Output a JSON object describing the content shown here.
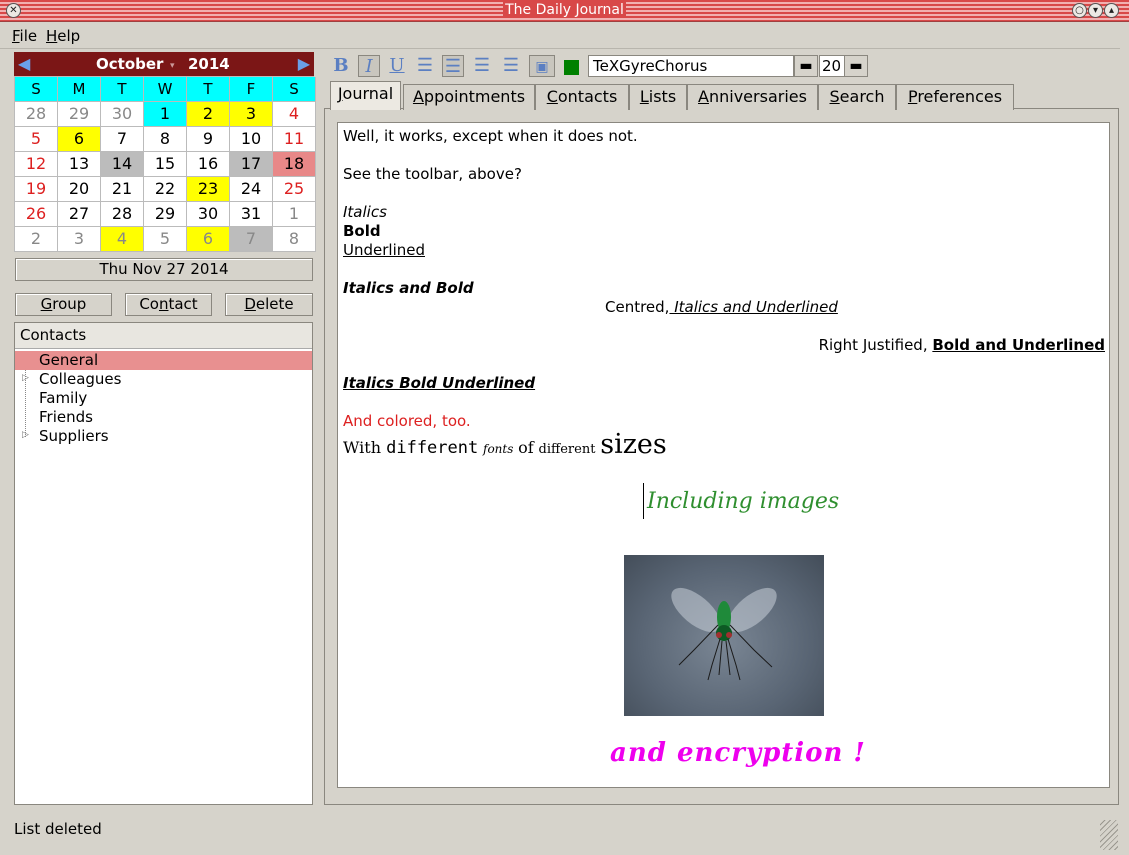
{
  "window": {
    "title": "The Daily Journal"
  },
  "menu": {
    "file": "File",
    "help": "Help"
  },
  "calendar": {
    "month": "October",
    "year": "2014",
    "weekdays": [
      "S",
      "M",
      "T",
      "W",
      "T",
      "F",
      "S"
    ],
    "weeks": [
      [
        "28",
        "29",
        "30",
        "1",
        "2",
        "3",
        "4"
      ],
      [
        "5",
        "6",
        "7",
        "8",
        "9",
        "10",
        "11"
      ],
      [
        "12",
        "13",
        "14",
        "15",
        "16",
        "17",
        "18"
      ],
      [
        "19",
        "20",
        "21",
        "22",
        "23",
        "24",
        "25"
      ],
      [
        "26",
        "27",
        "28",
        "29",
        "30",
        "31",
        "1"
      ],
      [
        "2",
        "3",
        "4",
        "5",
        "6",
        "7",
        "8"
      ]
    ],
    "selected_date": "Thu Nov 27 2014"
  },
  "buttons": {
    "group": "Group",
    "contact": "Contact",
    "delete": "Delete"
  },
  "contacts_tree": {
    "header": "Contacts",
    "items": [
      "General",
      "Colleagues",
      "Family",
      "Friends",
      "Suppliers"
    ]
  },
  "status": "List deleted",
  "toolbar": {
    "font": "TeXGyreChorus",
    "size": "20",
    "color": "#008000"
  },
  "tabs": [
    "Journal",
    "Appointments",
    "Contacts",
    "Lists",
    "Anniversaries",
    "Search",
    "Preferences"
  ],
  "journal": {
    "line1": "Well, it works, except when it does not.",
    "line2": "See the toolbar, above?",
    "italics": "Italics",
    "bold": "Bold",
    "underlined": "Underlined",
    "italics_bold": "Italics and Bold",
    "centred_a": "Centred,",
    "centred_b": " Italics and Underlined",
    "right_a": "Right Justified, ",
    "right_b": "Bold and Underlined",
    "ibu": "Italics Bold Underlined ",
    "colored": "And colored, too.",
    "fonts_with": "With ",
    "fonts_different": "different",
    "fonts_fonts": "fonts",
    "fonts_of": "of",
    "fonts_different2": "different",
    "fonts_sizes": "sizes",
    "images": "Including images",
    "encryption": "and encryption !"
  }
}
